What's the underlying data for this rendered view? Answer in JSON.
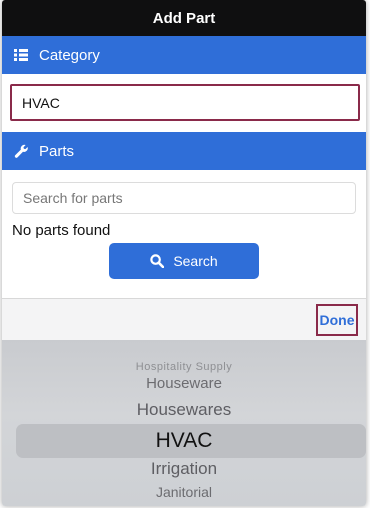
{
  "window": {
    "title": "Add Part"
  },
  "category_section": {
    "label": "Category",
    "icon": "grid-list-icon",
    "value": "HVAC"
  },
  "parts_section": {
    "label": "Parts",
    "icon": "wrench-icon",
    "search_placeholder": "Search for parts",
    "empty_message": "No parts found",
    "search_button_label": "Search",
    "search_button_icon": "search-icon"
  },
  "picker": {
    "done_label": "Done",
    "options": [
      "Hospitality Supply",
      "Houseware",
      "Housewares",
      "HVAC",
      "Irrigation",
      "Janitorial"
    ],
    "selected": "HVAC"
  },
  "colors": {
    "accent": "#2f6ed8",
    "highlight_border": "#8a2a4a",
    "titlebar": "#0f0f10"
  }
}
